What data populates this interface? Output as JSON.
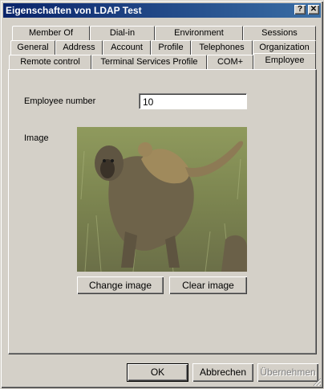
{
  "window": {
    "title": "Eigenschaften von LDAP Test",
    "help_label": "?",
    "close_label": "✕"
  },
  "tabs": {
    "row1": [
      "Member Of",
      "Dial-in",
      "Environment",
      "Sessions"
    ],
    "row2": [
      "General",
      "Address",
      "Account",
      "Profile",
      "Telephones",
      "Organization"
    ],
    "row3": [
      "Remote control",
      "Terminal Services Profile",
      "COM+",
      "Employee"
    ],
    "active": "Employee"
  },
  "employee": {
    "number_label": "Employee number",
    "number_value": "10",
    "image_label": "Image",
    "change_image_label": "Change image",
    "clear_image_label": "Clear image"
  },
  "footer": {
    "ok_label": "OK",
    "cancel_label": "Abbrechen",
    "apply_label": "Übernehmen"
  },
  "colors": {
    "title_start": "#0a246a",
    "title_end": "#3a6ea5",
    "face": "#d4d0c8"
  },
  "icons": [
    "help-icon",
    "close-icon",
    "resize-grip-icon"
  ]
}
